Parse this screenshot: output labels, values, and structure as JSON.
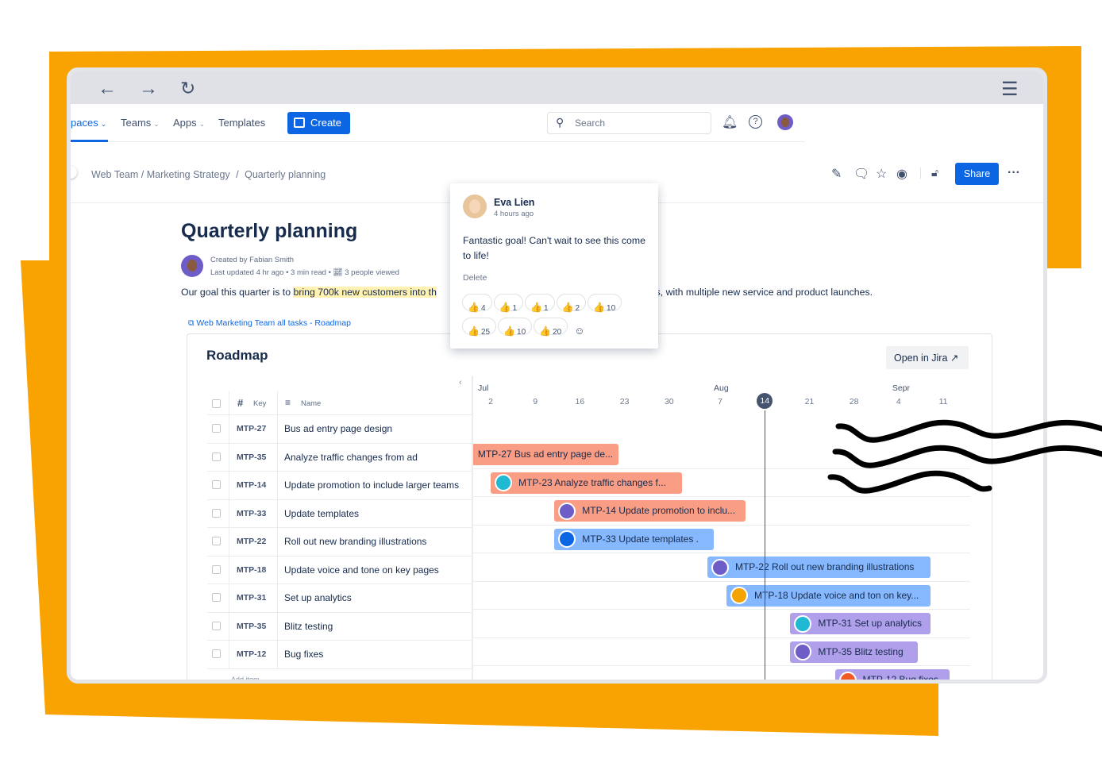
{
  "colors": {
    "orange": "#f9a303",
    "primary": "#0c66e4",
    "salmon": "#f99d85",
    "blue": "#85b8ff",
    "purple": "#b0a0ec"
  },
  "browser": {
    "back_icon": "arrow-left",
    "forward_icon": "arrow-right",
    "reload_icon": "reload",
    "menu_icon": "hamburger"
  },
  "nav": {
    "spaces": "paces",
    "teams": "Teams",
    "apps": "Apps",
    "templates": "Templates",
    "create": "Create",
    "search_placeholder": "Search"
  },
  "breadcrumb": [
    "Web Team /",
    "Marketing Strategy",
    "/",
    "Quarterly planning"
  ],
  "actions": {
    "share": "Share"
  },
  "page": {
    "title": "Quarterly planning",
    "created_by": "Created by Fabian Smith",
    "last_updated": "Last updated 4 hr ago",
    "read_time": "3 min read",
    "viewed": "3 people viewed",
    "para_before": "Our goal this quarter is to ",
    "para_highlight": "bring 700k new customers into th",
    "para_after": "f us, with multiple new service and product launches."
  },
  "roadmap": {
    "link": "Web Marketing Team all tasks - Roadmap",
    "title": "Roadmap",
    "open_jira": "Open in Jira",
    "col_key": "Key",
    "col_name": "Name",
    "months": [
      {
        "label": "Jul",
        "date": "07-01"
      },
      {
        "label": "Aug",
        "date": "08-07"
      },
      {
        "label": "Sepr",
        "date": "09-04"
      }
    ],
    "weeks": [
      {
        "label": "2",
        "date": "07-02"
      },
      {
        "label": "9",
        "date": "07-09"
      },
      {
        "label": "16",
        "date": "07-16"
      },
      {
        "label": "23",
        "date": "07-23"
      },
      {
        "label": "30",
        "date": "07-30"
      },
      {
        "label": "7",
        "date": "08-07"
      },
      {
        "label": "14",
        "date": "08-14",
        "today": true
      },
      {
        "label": "21",
        "date": "08-21"
      },
      {
        "label": "28",
        "date": "08-28"
      },
      {
        "label": "4",
        "date": "09-04"
      },
      {
        "label": "11",
        "date": "09-11"
      }
    ],
    "rows": [
      {
        "key": "MTP-27",
        "name": "Bus ad entry page design",
        "bar": "MTP-27 Bus ad entry page de...",
        "start": "06-29",
        "end": "07-22",
        "color": "#f99d85",
        "avatar": null
      },
      {
        "key": "MTP-35",
        "name": "Analyze traffic changes from ad",
        "bar": "MTP-23 Analyze traffic changes f...",
        "start": "07-02",
        "end": "08-01",
        "color": "#f99d85",
        "avatar": "#1fb9d4"
      },
      {
        "key": "MTP-14",
        "name": "Update promotion to include larger teams",
        "bar": "MTP-14 Update promotion to inclu...",
        "start": "07-12",
        "end": "08-11",
        "color": "#f99d85",
        "avatar": "#6e5dc6"
      },
      {
        "key": "MTP-33",
        "name": "Update templates",
        "bar": "MTP-33 Update templates .",
        "start": "07-12",
        "end": "08-06",
        "color": "#85b8ff",
        "avatar": "#0c66e4"
      },
      {
        "key": "MTP-22",
        "name": "Roll out new branding illustrations",
        "bar": "MTP-22 Roll out new branding illustrations",
        "start": "08-05",
        "end": "09-09",
        "color": "#85b8ff",
        "avatar": "#6e5dc6"
      },
      {
        "key": "MTP-18",
        "name": "Update voice and tone on key pages",
        "bar": "MTP-18 Update voice and ton on key...",
        "start": "08-08",
        "end": "09-09",
        "color": "#85b8ff",
        "avatar": "#f5a300"
      },
      {
        "key": "MTP-31",
        "name": "Set up analytics",
        "bar": "MTP-31 Set up analytics",
        "start": "08-18",
        "end": "09-09",
        "color": "#b0a0ec",
        "avatar": "#1fb9d4"
      },
      {
        "key": "MTP-35",
        "name": "Blitz testing",
        "bar": "MTP-35 Blitz testing",
        "start": "08-18",
        "end": "09-07",
        "color": "#b0a0ec",
        "avatar": "#6e5dc6"
      },
      {
        "key": "MTP-12",
        "name": "Bug fixes",
        "bar": "MTP-12 Bug fixes",
        "start": "08-25",
        "end": "09-12",
        "color": "#b0a0ec",
        "avatar": "#f15a24"
      }
    ],
    "add_item": "Add item"
  },
  "comment": {
    "author": "Eva Lien",
    "time": "4 hours ago",
    "text": "Fantastic goal! Can't wait to see this come to life!",
    "delete": "Delete",
    "reactions": [
      "4",
      "1",
      "1",
      "2",
      "10",
      "25",
      "10",
      "20"
    ]
  }
}
